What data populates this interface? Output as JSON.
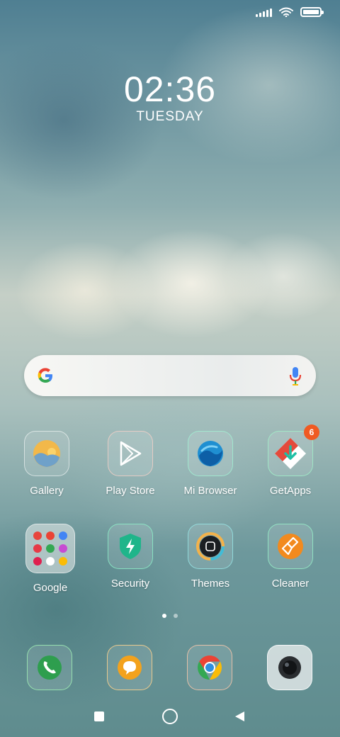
{
  "status_bar": {
    "icons": [
      "signal-icon",
      "wifi-icon",
      "battery-icon"
    ],
    "battery_level": 1.0
  },
  "clock": {
    "time": "02:36",
    "day": "TUESDAY"
  },
  "search": {
    "icons": [
      "google-logo-icon",
      "microphone-icon"
    ]
  },
  "apps_row1": [
    {
      "label": "Gallery",
      "icon": "gallery-icon"
    },
    {
      "label": "Play Store",
      "icon": "play-store-icon"
    },
    {
      "label": "Mi Browser",
      "icon": "mi-browser-icon"
    },
    {
      "label": "GetApps",
      "icon": "getapps-icon",
      "badge": "6"
    }
  ],
  "apps_row2": [
    {
      "label": "Google",
      "icon": "google-folder-icon"
    },
    {
      "label": "Security",
      "icon": "security-icon"
    },
    {
      "label": "Themes",
      "icon": "themes-icon"
    },
    {
      "label": "Cleaner",
      "icon": "cleaner-icon"
    }
  ],
  "page_indicator": {
    "pages": 2,
    "current": 1
  },
  "dock": [
    "phone-icon",
    "messaging-icon",
    "chrome-icon",
    "camera-icon"
  ],
  "nav_bar": [
    "recents-button",
    "home-button",
    "back-button"
  ],
  "colors": {
    "badge": "#f05a22",
    "phone": "#2e9e4e",
    "messaging": "#f3a21d",
    "chrome_blue": "#2f8fe0",
    "security": "#1fb58a",
    "cleaner": "#f28a1e",
    "getapps_red": "#e44a3c"
  }
}
